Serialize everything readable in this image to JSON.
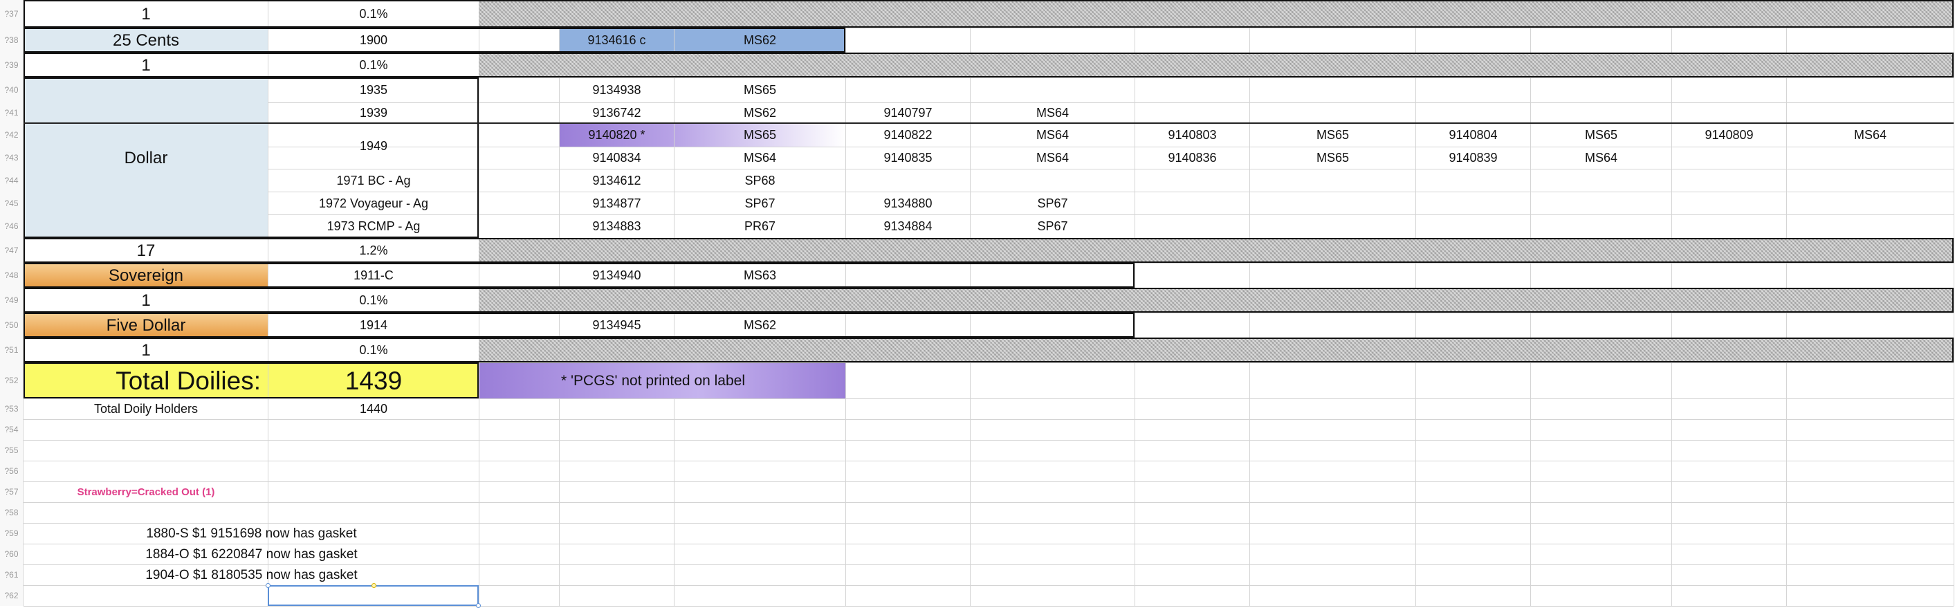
{
  "colors": {
    "light_blue": "#dde9f1",
    "orange_gradient_top": "#f7cf93",
    "orange_gradient_bottom": "#e79b43",
    "yellow": "#fafa66",
    "blue_highlight": "#8fb0de",
    "purple": "#9a7ed8",
    "strawberry_pink": "#e0408a",
    "hatch": "#b9b9b9"
  },
  "row_numbers": [
    "?37",
    "?38",
    "?39",
    "?40",
    "?41",
    "?42",
    "?43",
    "?44",
    "?45",
    "?46",
    "?47",
    "?48",
    "?49",
    "?50",
    "?51",
    "?52",
    "?53",
    "?54",
    "?55",
    "?56",
    "?57",
    "?58",
    "?59",
    "?60",
    "?61",
    "?62"
  ],
  "cells": [
    {
      "r": 0,
      "c": "A",
      "t": "1",
      "fs": 24
    },
    {
      "r": 0,
      "c": "B",
      "t": "0.1%"
    },
    {
      "r": 1,
      "c": "A",
      "t": "25 Cents",
      "fs": 24,
      "fill": "lb"
    },
    {
      "r": 1,
      "c": "B",
      "t": "1900"
    },
    {
      "r": 1,
      "c": "D",
      "t": "9134616 c",
      "fill": "blue"
    },
    {
      "r": 1,
      "c": "E",
      "t": "MS62",
      "fill": "blue"
    },
    {
      "r": 2,
      "c": "A",
      "t": "1",
      "fs": 24
    },
    {
      "r": 2,
      "c": "B",
      "t": "0.1%"
    },
    {
      "r": 3,
      "c": "A",
      "rs": 7,
      "t": "Dollar",
      "fs": 24,
      "fill": "lb"
    },
    {
      "r": 3,
      "c": "B",
      "t": "1935"
    },
    {
      "r": 3,
      "c": "D",
      "t": "9134938"
    },
    {
      "r": 3,
      "c": "E",
      "t": "MS65"
    },
    {
      "r": 4,
      "c": "B",
      "t": "1939"
    },
    {
      "r": 4,
      "c": "D",
      "t": "9136742"
    },
    {
      "r": 4,
      "c": "E",
      "t": "MS62"
    },
    {
      "r": 4,
      "c": "F",
      "t": "9140797"
    },
    {
      "r": 4,
      "c": "G",
      "t": "MS64"
    },
    {
      "r": 5,
      "c": "B",
      "rs": 2,
      "t": "1949"
    },
    {
      "r": 5,
      "c": "D",
      "t": "9140820 *",
      "fill": "purpleL"
    },
    {
      "r": 5,
      "c": "E",
      "t": "MS65",
      "fill": "purpleR"
    },
    {
      "r": 5,
      "c": "F",
      "t": "9140822"
    },
    {
      "r": 5,
      "c": "G",
      "t": "MS64"
    },
    {
      "r": 5,
      "c": "H",
      "t": "9140803"
    },
    {
      "r": 5,
      "c": "I",
      "t": "MS65"
    },
    {
      "r": 5,
      "c": "J",
      "t": "9140804"
    },
    {
      "r": 5,
      "c": "K",
      "t": "MS65"
    },
    {
      "r": 5,
      "c": "L",
      "t": "9140809"
    },
    {
      "r": 5,
      "c": "M",
      "t": "MS64"
    },
    {
      "r": 6,
      "c": "D",
      "t": "9140834"
    },
    {
      "r": 6,
      "c": "E",
      "t": "MS64"
    },
    {
      "r": 6,
      "c": "F",
      "t": "9140835"
    },
    {
      "r": 6,
      "c": "G",
      "t": "MS64"
    },
    {
      "r": 6,
      "c": "H",
      "t": "9140836"
    },
    {
      "r": 6,
      "c": "I",
      "t": "MS65"
    },
    {
      "r": 6,
      "c": "J",
      "t": "9140839"
    },
    {
      "r": 6,
      "c": "K",
      "t": "MS64"
    },
    {
      "r": 7,
      "c": "B",
      "t": "1971 BC - Ag"
    },
    {
      "r": 7,
      "c": "D",
      "t": "9134612"
    },
    {
      "r": 7,
      "c": "E",
      "t": "SP68"
    },
    {
      "r": 8,
      "c": "B",
      "t": "1972 Voyageur - Ag"
    },
    {
      "r": 8,
      "c": "D",
      "t": "9134877"
    },
    {
      "r": 8,
      "c": "E",
      "t": "SP67"
    },
    {
      "r": 8,
      "c": "F",
      "t": "9134880"
    },
    {
      "r": 8,
      "c": "G",
      "t": "SP67"
    },
    {
      "r": 9,
      "c": "B",
      "t": "1973 RCMP - Ag"
    },
    {
      "r": 9,
      "c": "D",
      "t": "9134883"
    },
    {
      "r": 9,
      "c": "E",
      "t": "PR67"
    },
    {
      "r": 9,
      "c": "F",
      "t": "9134884"
    },
    {
      "r": 9,
      "c": "G",
      "t": "SP67"
    },
    {
      "r": 10,
      "c": "A",
      "t": "17",
      "fs": 24
    },
    {
      "r": 10,
      "c": "B",
      "t": "1.2%"
    },
    {
      "r": 11,
      "c": "A",
      "t": "Sovereign",
      "fs": 24,
      "fill": "orange"
    },
    {
      "r": 11,
      "c": "B",
      "t": "1911-C"
    },
    {
      "r": 11,
      "c": "D",
      "t": "9134940"
    },
    {
      "r": 11,
      "c": "E",
      "t": "MS63"
    },
    {
      "r": 12,
      "c": "A",
      "t": "1",
      "fs": 24
    },
    {
      "r": 12,
      "c": "B",
      "t": "0.1%"
    },
    {
      "r": 13,
      "c": "A",
      "t": "Five Dollar",
      "fs": 24,
      "fill": "orange"
    },
    {
      "r": 13,
      "c": "B",
      "t": "1914"
    },
    {
      "r": 13,
      "c": "D",
      "t": "9134945"
    },
    {
      "r": 13,
      "c": "E",
      "t": "MS62"
    },
    {
      "r": 14,
      "c": "A",
      "t": "1",
      "fs": 24
    },
    {
      "r": 14,
      "c": "B",
      "t": "0.1%"
    },
    {
      "r": 15,
      "c": "A",
      "t": "Total Doilies:",
      "fs": 37,
      "fill": "yellow",
      "align": "right"
    },
    {
      "r": 15,
      "c": "B",
      "t": "1439",
      "fs": 37,
      "fill": "yellow"
    },
    {
      "r": 15,
      "c": "C",
      "cs": 3,
      "t": "* 'PCGS' not printed on label",
      "fs": 21,
      "fill": "purpleNote",
      "align": "left"
    },
    {
      "r": 16,
      "c": "A",
      "t": "Total Doily Holders",
      "fs": 18
    },
    {
      "r": 16,
      "c": "B",
      "t": "1440"
    },
    {
      "r": 20,
      "c": "A",
      "t": "Strawberry=Cracked Out (1)",
      "fs": 15,
      "pink": true
    },
    {
      "r": 22,
      "c": "A",
      "t": "1880-S $1 9151698 now has gasket",
      "fs": 19,
      "over": true
    },
    {
      "r": 23,
      "c": "A",
      "t": "1884-O $1 6220847 now has gasket",
      "fs": 19,
      "over": true
    },
    {
      "r": 24,
      "c": "A",
      "t": "1904-O $1 8180535 now has gasket",
      "fs": 19,
      "over": true
    }
  ],
  "hatched_rows": [
    0,
    2,
    10,
    12,
    14
  ],
  "selected_cell": {
    "r": 25,
    "c": "B"
  }
}
